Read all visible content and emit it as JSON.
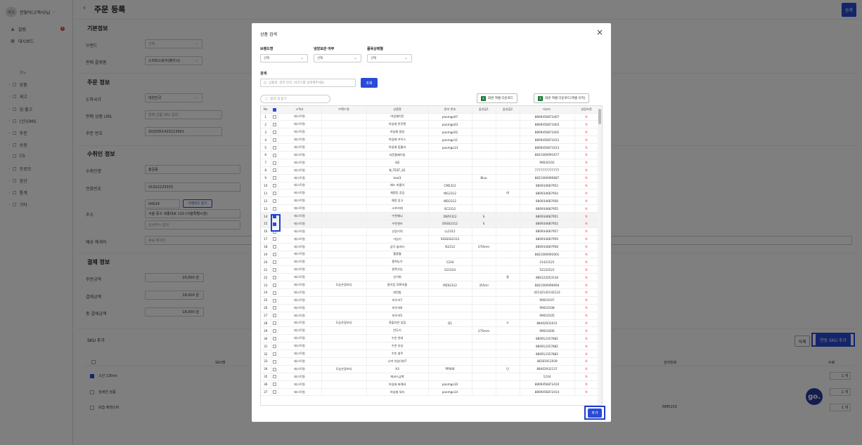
{
  "sidebar": {
    "user": "한빛어(고객사)님",
    "avatar": "최고",
    "badge": "0",
    "top_items": [
      {
        "label": "알림",
        "icon": "bell-icon"
      },
      {
        "label": "대시보드",
        "icon": "grid-icon"
      }
    ],
    "menu_header": "메뉴",
    "menu_items": [
      "상품",
      "재고",
      "입·출고",
      "(신)OMS",
      "주문",
      "송장",
      "CS",
      "프로모",
      "정산",
      "통계",
      "기타"
    ]
  },
  "header": {
    "back": "‹",
    "title": "주문 등록",
    "register": "등록"
  },
  "form": {
    "basic_title": "기본정보",
    "brand_label": "브랜드",
    "brand_value": "선택",
    "channel_label": "판매 플랫폼",
    "channel_value": "스마트스토어(플러시)",
    "order_title": "주문 정보",
    "country_label": "도착국가",
    "country_value": "대한민국",
    "url_label": "판매 상품 URL",
    "url_placeholder": "판매 상품 URL 입력",
    "orderno_label": "주문 번호",
    "orderno_value": "2025051423113901",
    "recv_title": "수취인 정보",
    "name_label": "수취인명",
    "name_value": "홍길동",
    "phone_label": "전화번호",
    "phone_value": "01022223333",
    "zip_value": "04524",
    "zip_btn": "우편번호 찾기",
    "addr_label": "주소",
    "addr_value": "서울 중구 세종대로 110 (서울특별시청)",
    "addr_detail": "상세주소 입력",
    "msg_label": "배송 메세지",
    "msg_placeholder": "배송 메세지",
    "pay_title": "결제 정보",
    "amt_label": "주문금액",
    "amt_value": "20,000",
    "amt_unit": "원",
    "payamt_label": "결제금액",
    "payamt_value": "18,000",
    "payamt_unit": "원",
    "total_label": "총 결제금액",
    "total_value": "18,000",
    "total_unit": "원",
    "sku_title": "SKU 추가",
    "delete_btn": "삭제",
    "add_sku_btn": "연동 SKU 추가",
    "sku_col": "SKU명",
    "mgmt_col": "관리번호",
    "qty_col": "수량",
    "sku_rows": [
      {
        "name": "스킨 130ml",
        "mgmt": "",
        "qty": "1"
      },
      {
        "name": "상세진 상품",
        "mgmt": "",
        "qty": "1"
      },
      {
        "name": "보습 에센스바",
        "mgmt": "NM0103",
        "qty": "1"
      }
    ],
    "qty_unit": "개"
  },
  "modal": {
    "title": "상품 검색",
    "close": "×",
    "f_brand": "브랜드명",
    "f_brand_v": "선택",
    "f_cold": "냉장보관 여부",
    "f_cold_v": "선택",
    "f_status": "품목상태별",
    "f_status_v": "선택",
    "search_label": "검색",
    "search_placeholder": "상품명, 관리 번호, 바코드를 입력해주세요.",
    "query_btn": "조회",
    "result_search": "결과 내 찾기",
    "excel1": "화면 엑셀 다운로드",
    "excel2": "화면 엑셀 다운로드(엑셀 유지)",
    "columns": [
      "No",
      "",
      "고객사",
      "브랜드명",
      "상품명",
      "관리 번호",
      "옵션값1",
      "옵션값2",
      "바코드",
      "냉장보관"
    ],
    "rows": [
      [
        "1",
        "테스트원",
        "",
        "아임쉐이킨",
        "poomgo07",
        "",
        "",
        "8809456873407",
        "N"
      ],
      [
        "2",
        "테스트원",
        "",
        "아임쉐 빈후렌",
        "poomgo03",
        "",
        "",
        "8809456873403",
        "N"
      ],
      [
        "3",
        "테스트원",
        "",
        "아임쉐 잠실",
        "poomgo02",
        "",
        "",
        "8809456873402",
        "N"
      ],
      [
        "4",
        "테스트원",
        "",
        "아임쉐 아이스",
        "poomgo11",
        "",
        "",
        "8809456873411",
        "N"
      ],
      [
        "5",
        "테스트원",
        "",
        "아임쉐 탐블러",
        "poomgo13",
        "",
        "",
        "8809456873413",
        "N"
      ],
      [
        "6",
        "테스트원",
        "",
        "서운올베이송",
        "",
        "",
        "",
        "8821000991677",
        "N"
      ],
      [
        "7",
        "테스트원",
        "",
        "테2",
        "",
        "",
        "",
        "99020102",
        "N"
      ],
      [
        "8",
        "테스트원",
        "",
        "N_TEST_02",
        "",
        "",
        "",
        "7777777777777",
        "N"
      ],
      [
        "9",
        "테스트원",
        "",
        "test3",
        "",
        "Blue",
        "",
        "8821000990687",
        "N"
      ],
      [
        "10",
        "테스트원",
        "",
        "레드 비롬이",
        "CM2312",
        "",
        "",
        "880934687953",
        "N"
      ],
      [
        "11",
        "테스트원",
        "",
        "게용팀 공입",
        "WG2312",
        "",
        "대",
        "880934687954",
        "N"
      ],
      [
        "12",
        "테스트원",
        "",
        "게용 입고",
        "WD2312",
        "",
        "",
        "880934687956",
        "N"
      ],
      [
        "13",
        "테스트원",
        "",
        "소프커테",
        "SC2312",
        "",
        "",
        "880934687955",
        "N"
      ],
      [
        "14",
        "테스트원",
        "",
        "수련매니",
        "DSP2312",
        "S",
        "",
        "880934687951",
        "N"
      ],
      [
        "15",
        "테스트원",
        "",
        "수련셋뜨",
        "DSSS2312",
        "S",
        "",
        "880934687952",
        "N"
      ],
      [
        "16",
        "테스트원",
        "",
        "신장기억",
        "LL2312",
        "",
        "",
        "880934687957",
        "N"
      ],
      [
        "17",
        "테스트원",
        "",
        "가습기",
        "SSSSSS2312",
        "",
        "",
        "880934687959",
        "N"
      ],
      [
        "18",
        "테스트원",
        "",
        "삼각 솔리터",
        "IS2312",
        "270mm",
        "",
        "880934687958",
        "N"
      ],
      [
        "19",
        "테스트원",
        "",
        "헬용월",
        "",
        "",
        "",
        "8821000992001",
        "N"
      ],
      [
        "20",
        "테스트원",
        "",
        "흡착능우",
        "1234",
        "",
        "",
        "21421521",
        "N"
      ],
      [
        "21",
        "테스트원",
        "",
        "원폭가능",
        "521524",
        "",
        "",
        "52152521",
        "N"
      ],
      [
        "22",
        "테스트원",
        "",
        "신이위",
        "",
        "",
        "중",
        "880122053118",
        "N"
      ],
      [
        "23",
        "테스트원",
        "도농온광보다",
        "펌이킴 100저울",
        "MZ02312",
        "355ml",
        "",
        "8821000990694",
        "N"
      ],
      [
        "24",
        "테스트원",
        "",
        "파란밤",
        "",
        "",
        "",
        "42142142142123",
        "N"
      ],
      [
        "25",
        "테스트원",
        "",
        "피우카7",
        "",
        "",
        "",
        "99010107",
        "N"
      ],
      [
        "26",
        "테스트원",
        "",
        "피우카8",
        "",
        "",
        "",
        "99010108",
        "N"
      ],
      [
        "27",
        "테스트원",
        "",
        "피우카5",
        "",
        "",
        "",
        "99010105",
        "N"
      ],
      [
        "28",
        "테스트원",
        "도농온광보다",
        "큐플지한 업립",
        "Q1",
        "",
        "소",
        "88402931031",
        "N"
      ],
      [
        "29",
        "테스트원",
        "",
        "반도기",
        "",
        "275mm",
        "",
        "99010206",
        "N"
      ],
      [
        "30",
        "테스트원",
        "",
        "수빈 연대",
        "",
        "",
        "",
        "880912357881",
        "N"
      ],
      [
        "31",
        "테스트원",
        "",
        "수빈 부성",
        "",
        "",
        "",
        "880912357882",
        "N"
      ],
      [
        "32",
        "테스트원",
        "",
        "수빈 영주",
        "",
        "",
        "",
        "880912357883",
        "N"
      ],
      [
        "33",
        "테스트원",
        "",
        "너겨 아임이야7",
        "",
        "",
        "",
        "48281912939",
        "N"
      ],
      [
        "34",
        "테스트원",
        "도농온광보다",
        "A3",
        "PP006",
        "",
        "단",
        "88402932137",
        "N"
      ],
      [
        "35",
        "테스트원",
        "",
        "에코드금벽",
        "",
        "",
        "",
        "1234",
        "N"
      ],
      [
        "36",
        "테스트원",
        "",
        "아임쉐 버례버",
        "poomgo10",
        "",
        "",
        "8809456873410",
        "N"
      ],
      [
        "37",
        "테스트원",
        "",
        "아임쉐 뒤지",
        "poomgo14",
        "",
        "",
        "8809456873414",
        "N"
      ]
    ],
    "add_btn": "추가"
  },
  "help": "go."
}
